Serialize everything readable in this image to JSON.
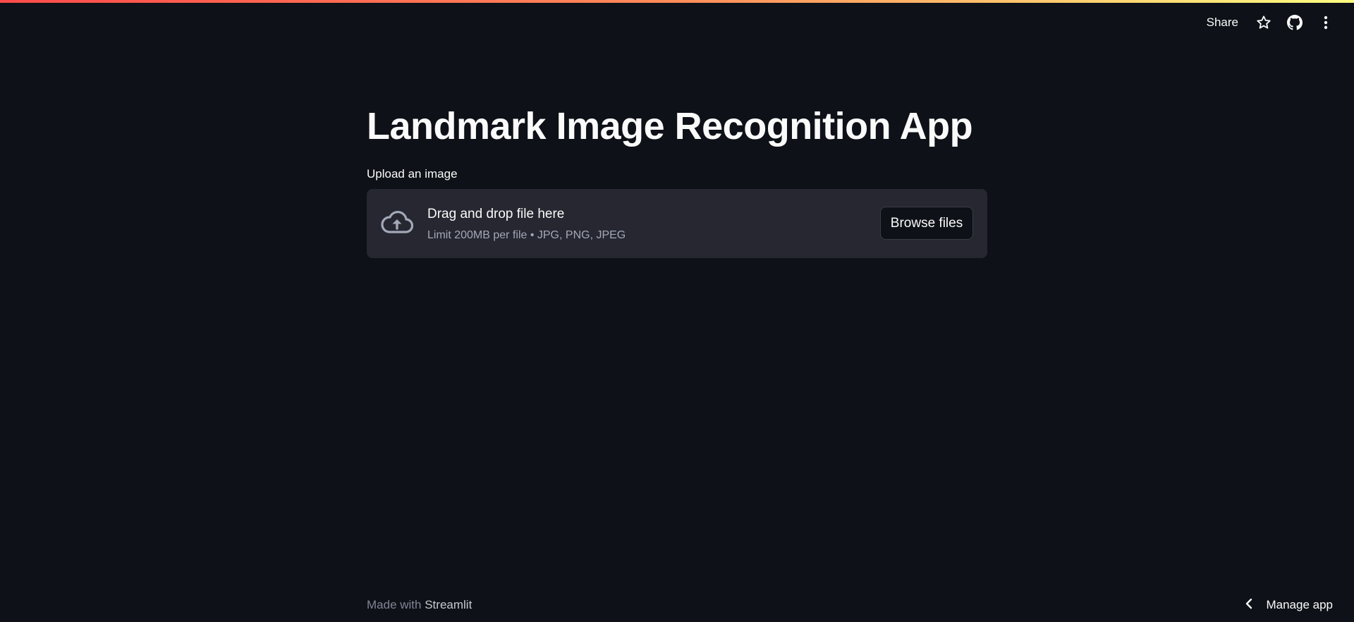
{
  "toolbar": {
    "share_label": "Share",
    "icons": [
      "star-icon",
      "github-icon",
      "more-vertical-icon"
    ]
  },
  "page": {
    "title": "Landmark Image Recognition App"
  },
  "uploader": {
    "label": "Upload an image",
    "drop_text": "Drag and drop file here",
    "limit_text": "Limit 200MB per file • JPG, PNG, JPEG",
    "browse_label": "Browse files",
    "icon": "cloud-upload-icon"
  },
  "footer": {
    "made_with": "Made with",
    "brand": "Streamlit"
  },
  "manage": {
    "label": "Manage app",
    "icon": "chevron-left-icon"
  },
  "colors": {
    "background": "#0e1117",
    "dropzone": "#262730",
    "accent_gradient_start": "#ff4b4b",
    "accent_gradient_end": "#fffd80"
  }
}
